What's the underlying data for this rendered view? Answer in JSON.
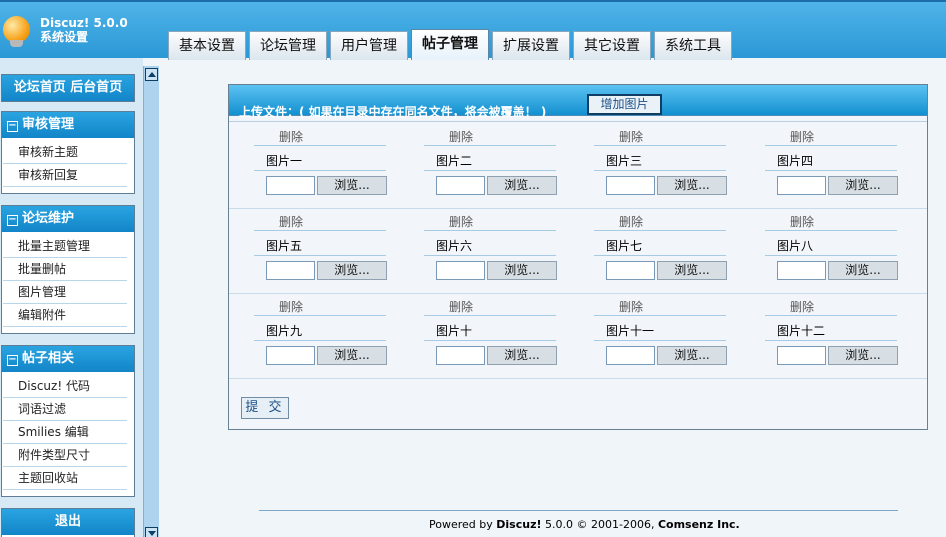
{
  "app": {
    "name": "Discuz! 5.0.0",
    "subtitle": "系统设置"
  },
  "tabs": [
    {
      "label": "基本设置",
      "active": false
    },
    {
      "label": "论坛管理",
      "active": false
    },
    {
      "label": "用户管理",
      "active": false
    },
    {
      "label": "帖子管理",
      "active": true
    },
    {
      "label": "扩展设置",
      "active": false
    },
    {
      "label": "其它设置",
      "active": false
    },
    {
      "label": "系统工具",
      "active": false
    }
  ],
  "sidebar": {
    "home_links": "论坛首页  后台首页",
    "sections": [
      {
        "title": "审核管理",
        "toggle": "−",
        "items": [
          "审核新主题",
          "审核新回复"
        ]
      },
      {
        "title": "论坛维护",
        "toggle": "−",
        "items": [
          "批量主题管理",
          "批量删帖",
          "图片管理",
          "编辑附件"
        ]
      },
      {
        "title": "帖子相关",
        "toggle": "−",
        "items": [
          "Discuz! 代码",
          "词语过滤",
          "Smilies 编辑",
          "附件类型尺寸",
          "主题回收站"
        ]
      }
    ],
    "logout": "退出"
  },
  "panel": {
    "header": "上传文件：( 如果在目录中存在同名文件，将会被覆盖！ )",
    "add_button": "增加图片",
    "delete_label": "删除",
    "browse_label": "浏览...",
    "images": [
      "图片一",
      "图片二",
      "图片三",
      "图片四",
      "图片五",
      "图片六",
      "图片七",
      "图片八",
      "图片九",
      "图片十",
      "图片十一",
      "图片十二"
    ],
    "submit": "提 交"
  },
  "footer": {
    "powered_by": "Powered by",
    "product": "Discuz!",
    "version": "5.0.0",
    "copyright": "© 2001-2006,",
    "company": "Comsenz Inc."
  },
  "colors": {
    "accent": "#1b8fd3",
    "header_bg": "#3aa6e0",
    "sidebar_head": "#1285c8"
  },
  "icons": {
    "logo": "lightbulb-icon",
    "collapse": "minus-box-icon",
    "scroll_up": "arrow-up-icon",
    "scroll_down": "arrow-down-icon"
  }
}
